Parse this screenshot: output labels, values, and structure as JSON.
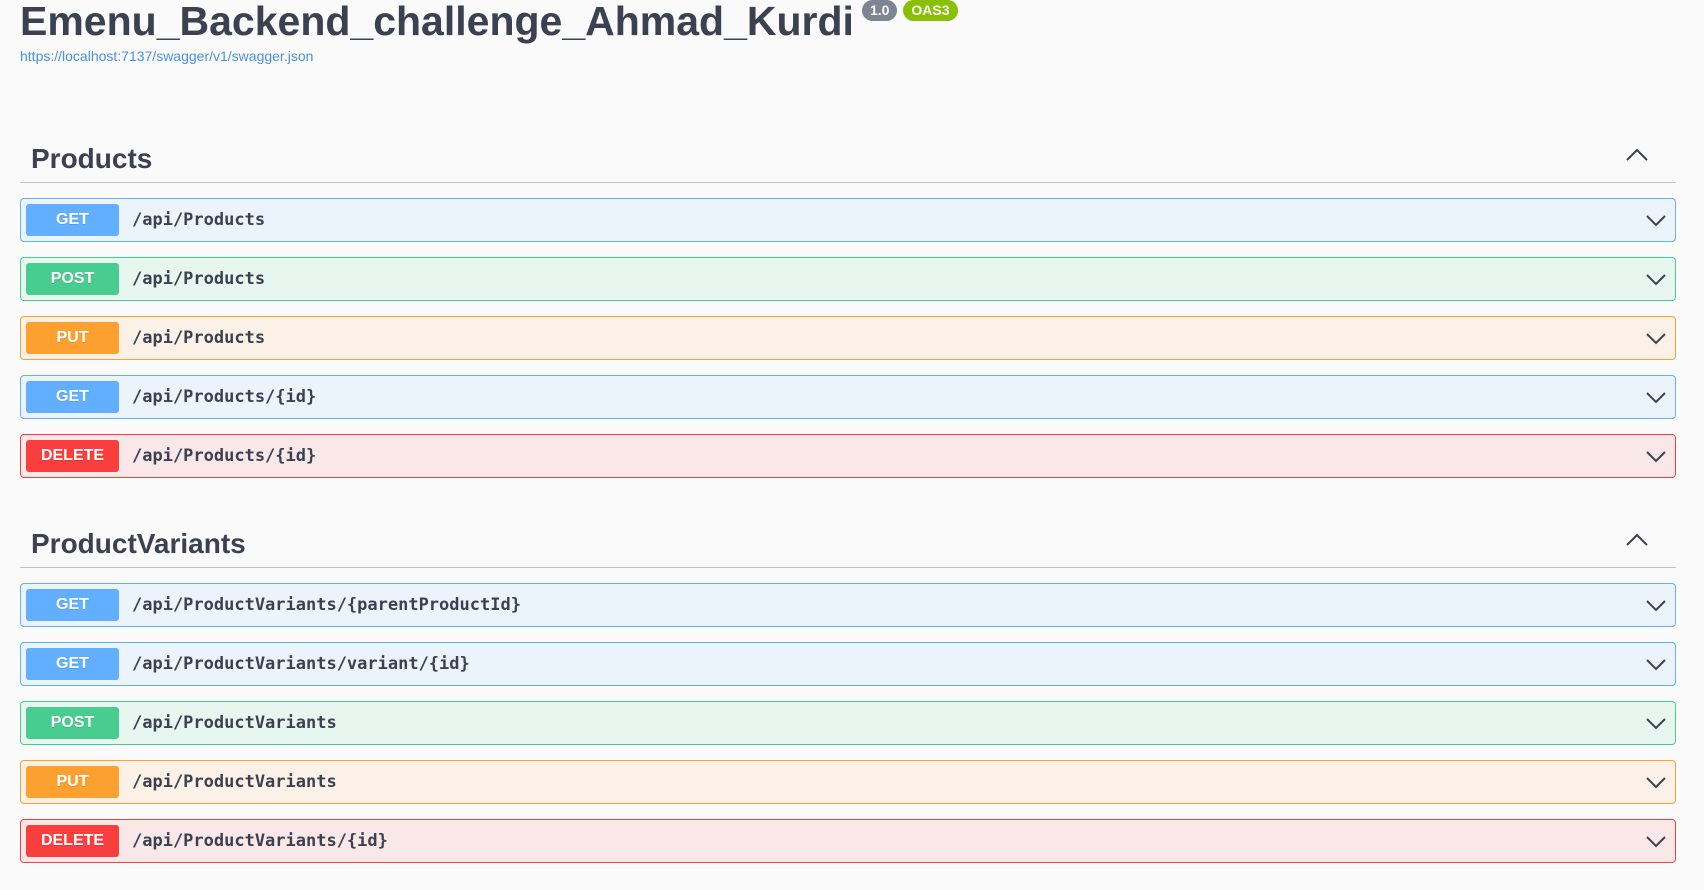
{
  "info": {
    "title": "Emenu_Backend_challenge_Ahmad_Kurdi",
    "version": "1.0",
    "oas_badge": "OAS3",
    "spec_url": "https://localhost:7137/swagger/v1/swagger.json"
  },
  "sections": [
    {
      "title": "Products",
      "operations": [
        {
          "method": "GET",
          "path": "/api/Products"
        },
        {
          "method": "POST",
          "path": "/api/Products"
        },
        {
          "method": "PUT",
          "path": "/api/Products"
        },
        {
          "method": "GET",
          "path": "/api/Products/{id}"
        },
        {
          "method": "DELETE",
          "path": "/api/Products/{id}"
        }
      ]
    },
    {
      "title": "ProductVariants",
      "operations": [
        {
          "method": "GET",
          "path": "/api/ProductVariants/{parentProductId}"
        },
        {
          "method": "GET",
          "path": "/api/ProductVariants/variant/{id}"
        },
        {
          "method": "POST",
          "path": "/api/ProductVariants"
        },
        {
          "method": "PUT",
          "path": "/api/ProductVariants"
        },
        {
          "method": "DELETE",
          "path": "/api/ProductVariants/{id}"
        }
      ]
    }
  ],
  "icons": {
    "section_toggle": "chevron-up-icon",
    "operation_toggle": "chevron-down-icon"
  },
  "colors": {
    "get": "#61affe",
    "post": "#49cc90",
    "put": "#fca130",
    "delete": "#f93e3e",
    "version_badge": "#7d8492",
    "oas_badge": "#89bf04",
    "link": "#4990e2"
  }
}
